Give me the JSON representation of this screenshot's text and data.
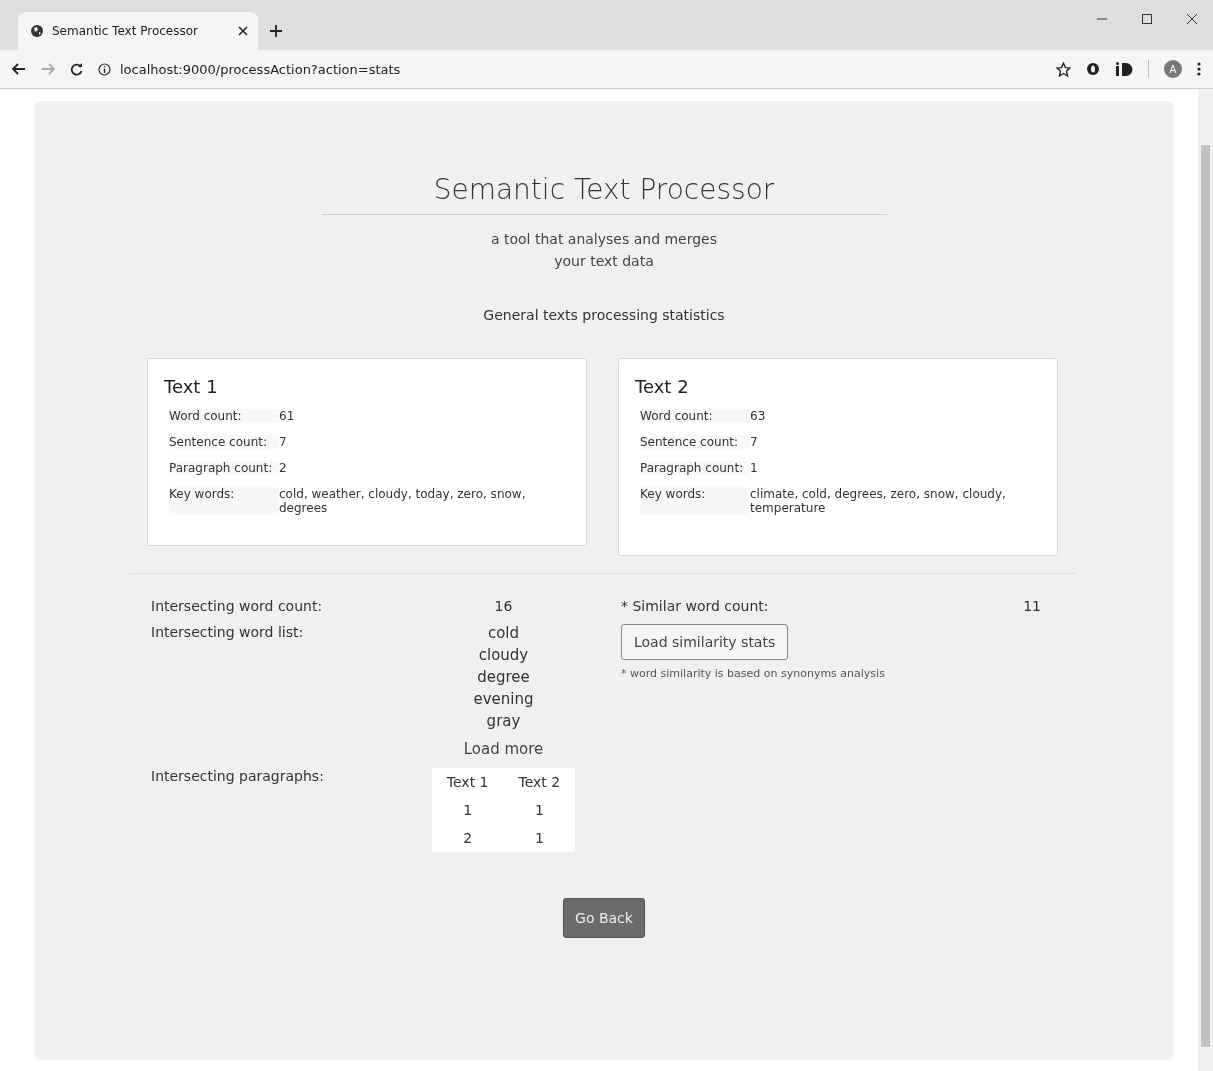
{
  "browser": {
    "tab_title": "Semantic Text Processor",
    "url": "localhost:9000/processAction?action=stats",
    "profile_initial": "A"
  },
  "header": {
    "title": "Semantic Text Processor",
    "subtitle_lines": [
      "a tool that analyses and merges",
      "your text data"
    ],
    "section_title": "General texts processing statistics"
  },
  "cards": [
    {
      "title": "Text 1",
      "rows": [
        {
          "label": "Word count:",
          "value": "61"
        },
        {
          "label": "Sentence count:",
          "value": "7"
        },
        {
          "label": "Paragraph count:",
          "value": "2"
        },
        {
          "label": "Key words:",
          "value": "cold, weather, cloudy, today, zero, snow, degrees"
        }
      ]
    },
    {
      "title": "Text 2",
      "rows": [
        {
          "label": "Word count:",
          "value": "63"
        },
        {
          "label": "Sentence count:",
          "value": "7"
        },
        {
          "label": "Paragraph count:",
          "value": "1"
        },
        {
          "label": "Key words:",
          "value": "climate, cold, degrees, zero, snow, cloudy, temperature"
        }
      ]
    }
  ],
  "intersection": {
    "count_label": "Intersecting word count:",
    "count": "16",
    "list_label": "Intersecting word list:",
    "words": [
      "cold",
      "cloudy",
      "degree",
      "evening",
      "gray"
    ],
    "load_more": "Load more",
    "paragraphs_label": "Intersecting paragraphs:",
    "paragraphs_columns": [
      "Text 1",
      "Text 2"
    ],
    "paragraphs_rows": [
      [
        "1",
        "1"
      ],
      [
        "2",
        "1"
      ]
    ]
  },
  "similarity": {
    "label": "* Similar word count:",
    "count": "11",
    "button": "Load similarity stats",
    "note": "* word similarity is based on synonyms analysis"
  },
  "go_back": "Go Back"
}
